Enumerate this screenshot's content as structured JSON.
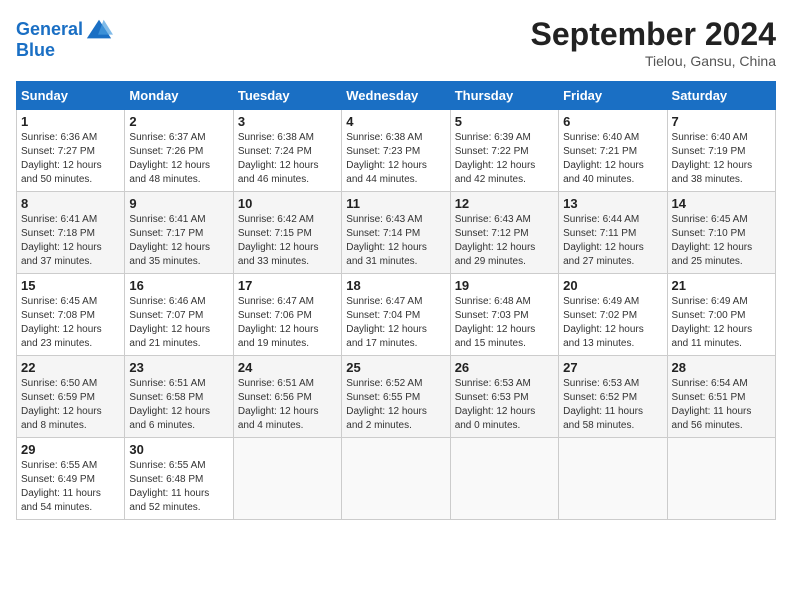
{
  "header": {
    "logo_line1": "General",
    "logo_line2": "Blue",
    "month": "September 2024",
    "location": "Tielou, Gansu, China"
  },
  "weekdays": [
    "Sunday",
    "Monday",
    "Tuesday",
    "Wednesday",
    "Thursday",
    "Friday",
    "Saturday"
  ],
  "weeks": [
    [
      {
        "day": "1",
        "info": "Sunrise: 6:36 AM\nSunset: 7:27 PM\nDaylight: 12 hours\nand 50 minutes."
      },
      {
        "day": "2",
        "info": "Sunrise: 6:37 AM\nSunset: 7:26 PM\nDaylight: 12 hours\nand 48 minutes."
      },
      {
        "day": "3",
        "info": "Sunrise: 6:38 AM\nSunset: 7:24 PM\nDaylight: 12 hours\nand 46 minutes."
      },
      {
        "day": "4",
        "info": "Sunrise: 6:38 AM\nSunset: 7:23 PM\nDaylight: 12 hours\nand 44 minutes."
      },
      {
        "day": "5",
        "info": "Sunrise: 6:39 AM\nSunset: 7:22 PM\nDaylight: 12 hours\nand 42 minutes."
      },
      {
        "day": "6",
        "info": "Sunrise: 6:40 AM\nSunset: 7:21 PM\nDaylight: 12 hours\nand 40 minutes."
      },
      {
        "day": "7",
        "info": "Sunrise: 6:40 AM\nSunset: 7:19 PM\nDaylight: 12 hours\nand 38 minutes."
      }
    ],
    [
      {
        "day": "8",
        "info": "Sunrise: 6:41 AM\nSunset: 7:18 PM\nDaylight: 12 hours\nand 37 minutes."
      },
      {
        "day": "9",
        "info": "Sunrise: 6:41 AM\nSunset: 7:17 PM\nDaylight: 12 hours\nand 35 minutes."
      },
      {
        "day": "10",
        "info": "Sunrise: 6:42 AM\nSunset: 7:15 PM\nDaylight: 12 hours\nand 33 minutes."
      },
      {
        "day": "11",
        "info": "Sunrise: 6:43 AM\nSunset: 7:14 PM\nDaylight: 12 hours\nand 31 minutes."
      },
      {
        "day": "12",
        "info": "Sunrise: 6:43 AM\nSunset: 7:12 PM\nDaylight: 12 hours\nand 29 minutes."
      },
      {
        "day": "13",
        "info": "Sunrise: 6:44 AM\nSunset: 7:11 PM\nDaylight: 12 hours\nand 27 minutes."
      },
      {
        "day": "14",
        "info": "Sunrise: 6:45 AM\nSunset: 7:10 PM\nDaylight: 12 hours\nand 25 minutes."
      }
    ],
    [
      {
        "day": "15",
        "info": "Sunrise: 6:45 AM\nSunset: 7:08 PM\nDaylight: 12 hours\nand 23 minutes."
      },
      {
        "day": "16",
        "info": "Sunrise: 6:46 AM\nSunset: 7:07 PM\nDaylight: 12 hours\nand 21 minutes."
      },
      {
        "day": "17",
        "info": "Sunrise: 6:47 AM\nSunset: 7:06 PM\nDaylight: 12 hours\nand 19 minutes."
      },
      {
        "day": "18",
        "info": "Sunrise: 6:47 AM\nSunset: 7:04 PM\nDaylight: 12 hours\nand 17 minutes."
      },
      {
        "day": "19",
        "info": "Sunrise: 6:48 AM\nSunset: 7:03 PM\nDaylight: 12 hours\nand 15 minutes."
      },
      {
        "day": "20",
        "info": "Sunrise: 6:49 AM\nSunset: 7:02 PM\nDaylight: 12 hours\nand 13 minutes."
      },
      {
        "day": "21",
        "info": "Sunrise: 6:49 AM\nSunset: 7:00 PM\nDaylight: 12 hours\nand 11 minutes."
      }
    ],
    [
      {
        "day": "22",
        "info": "Sunrise: 6:50 AM\nSunset: 6:59 PM\nDaylight: 12 hours\nand 8 minutes."
      },
      {
        "day": "23",
        "info": "Sunrise: 6:51 AM\nSunset: 6:58 PM\nDaylight: 12 hours\nand 6 minutes."
      },
      {
        "day": "24",
        "info": "Sunrise: 6:51 AM\nSunset: 6:56 PM\nDaylight: 12 hours\nand 4 minutes."
      },
      {
        "day": "25",
        "info": "Sunrise: 6:52 AM\nSunset: 6:55 PM\nDaylight: 12 hours\nand 2 minutes."
      },
      {
        "day": "26",
        "info": "Sunrise: 6:53 AM\nSunset: 6:53 PM\nDaylight: 12 hours\nand 0 minutes."
      },
      {
        "day": "27",
        "info": "Sunrise: 6:53 AM\nSunset: 6:52 PM\nDaylight: 11 hours\nand 58 minutes."
      },
      {
        "day": "28",
        "info": "Sunrise: 6:54 AM\nSunset: 6:51 PM\nDaylight: 11 hours\nand 56 minutes."
      }
    ],
    [
      {
        "day": "29",
        "info": "Sunrise: 6:55 AM\nSunset: 6:49 PM\nDaylight: 11 hours\nand 54 minutes."
      },
      {
        "day": "30",
        "info": "Sunrise: 6:55 AM\nSunset: 6:48 PM\nDaylight: 11 hours\nand 52 minutes."
      },
      {
        "day": "",
        "info": ""
      },
      {
        "day": "",
        "info": ""
      },
      {
        "day": "",
        "info": ""
      },
      {
        "day": "",
        "info": ""
      },
      {
        "day": "",
        "info": ""
      }
    ]
  ]
}
